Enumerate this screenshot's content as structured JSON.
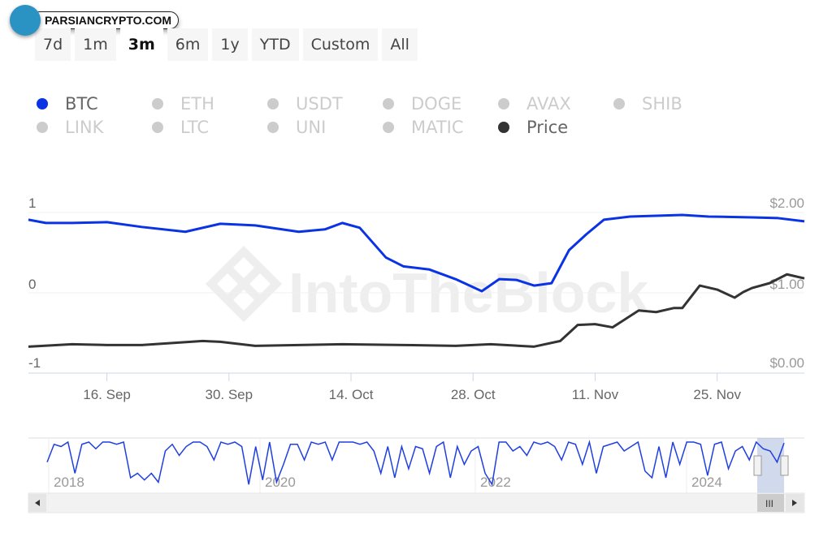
{
  "watermark_logo": "PARSIANCRYPTO.COM",
  "ranges": [
    {
      "label": "7d"
    },
    {
      "label": "1m"
    },
    {
      "label": "3m",
      "active": true
    },
    {
      "label": "6m"
    },
    {
      "label": "1y"
    },
    {
      "label": "YTD"
    },
    {
      "label": "Custom"
    },
    {
      "label": "All"
    }
  ],
  "legend": [
    {
      "label": "BTC",
      "color": "#0a33e6",
      "on": true
    },
    {
      "label": "ETH"
    },
    {
      "label": "USDT"
    },
    {
      "label": "DOGE"
    },
    {
      "label": "AVAX"
    },
    {
      "label": "SHIB"
    },
    {
      "label": "LINK"
    },
    {
      "label": "LTC"
    },
    {
      "label": "UNI"
    },
    {
      "label": "MATIC"
    },
    {
      "label": "Price",
      "color": "#333333",
      "on": true
    }
  ],
  "chart_data": {
    "type": "line",
    "watermark": "IntoTheBlock",
    "x_range": [
      "2024-09-07",
      "2024-12-05"
    ],
    "x_ticks": [
      {
        "date": "2024-09-16",
        "label": "16. Sep"
      },
      {
        "date": "2024-09-30",
        "label": "30. Sep"
      },
      {
        "date": "2024-10-14",
        "label": "14. Oct"
      },
      {
        "date": "2024-10-28",
        "label": "28. Oct"
      },
      {
        "date": "2024-11-11",
        "label": "11. Nov"
      },
      {
        "date": "2024-11-25",
        "label": "25. Nov"
      }
    ],
    "y_left": {
      "range": [
        -1,
        1
      ],
      "ticks": [
        "1",
        "0",
        "-1"
      ]
    },
    "y_right": {
      "range": [
        0,
        2
      ],
      "ticks": [
        "$2.00",
        "$1.00",
        "$0.00"
      ]
    },
    "grid": true,
    "series": [
      {
        "name": "BTC",
        "axis": "left",
        "color": "#0a33e6",
        "points": [
          [
            "2024-09-07",
            0.91
          ],
          [
            "2024-09-09",
            0.87
          ],
          [
            "2024-09-12",
            0.87
          ],
          [
            "2024-09-16",
            0.88
          ],
          [
            "2024-09-20",
            0.82
          ],
          [
            "2024-09-25",
            0.76
          ],
          [
            "2024-09-29",
            0.86
          ],
          [
            "2024-10-03",
            0.84
          ],
          [
            "2024-10-08",
            0.76
          ],
          [
            "2024-10-11",
            0.79
          ],
          [
            "2024-10-13",
            0.87
          ],
          [
            "2024-10-15",
            0.81
          ],
          [
            "2024-10-18",
            0.44
          ],
          [
            "2024-10-20",
            0.33
          ],
          [
            "2024-10-23",
            0.29
          ],
          [
            "2024-10-26",
            0.17
          ],
          [
            "2024-10-29",
            0.02
          ],
          [
            "2024-10-31",
            0.17
          ],
          [
            "2024-11-02",
            0.16
          ],
          [
            "2024-11-04",
            0.09
          ],
          [
            "2024-11-06",
            0.12
          ],
          [
            "2024-11-08",
            0.53
          ],
          [
            "2024-11-10",
            0.73
          ],
          [
            "2024-11-12",
            0.91
          ],
          [
            "2024-11-15",
            0.95
          ],
          [
            "2024-11-21",
            0.97
          ],
          [
            "2024-11-24",
            0.95
          ],
          [
            "2024-11-29",
            0.94
          ],
          [
            "2024-12-02",
            0.93
          ],
          [
            "2024-12-05",
            0.89
          ]
        ]
      },
      {
        "name": "Price",
        "axis": "right",
        "color": "#333333",
        "points": [
          [
            "2024-09-07",
            0.33
          ],
          [
            "2024-09-12",
            0.36
          ],
          [
            "2024-09-16",
            0.35
          ],
          [
            "2024-09-20",
            0.35
          ],
          [
            "2024-09-27",
            0.4
          ],
          [
            "2024-09-29",
            0.39
          ],
          [
            "2024-10-03",
            0.34
          ],
          [
            "2024-10-08",
            0.35
          ],
          [
            "2024-10-13",
            0.36
          ],
          [
            "2024-10-20",
            0.35
          ],
          [
            "2024-10-26",
            0.34
          ],
          [
            "2024-10-30",
            0.36
          ],
          [
            "2024-11-04",
            0.33
          ],
          [
            "2024-11-07",
            0.4
          ],
          [
            "2024-11-09",
            0.6
          ],
          [
            "2024-11-11",
            0.61
          ],
          [
            "2024-11-13",
            0.57
          ],
          [
            "2024-11-16",
            0.78
          ],
          [
            "2024-11-18",
            0.76
          ],
          [
            "2024-11-20",
            0.81
          ],
          [
            "2024-11-21",
            0.81
          ],
          [
            "2024-11-23",
            1.09
          ],
          [
            "2024-11-25",
            1.04
          ],
          [
            "2024-11-27",
            0.94
          ],
          [
            "2024-11-28",
            1.01
          ],
          [
            "2024-11-29",
            1.06
          ],
          [
            "2024-12-01",
            1.12
          ],
          [
            "2024-12-03",
            1.23
          ],
          [
            "2024-12-05",
            1.18
          ]
        ]
      }
    ],
    "navigator": {
      "year_labels": [
        "2018",
        "2020",
        "2022",
        "2024"
      ],
      "series": [
        0.55,
        0.95,
        0.9,
        1,
        0.3,
        0.95,
        1,
        0.85,
        1,
        1,
        0.95,
        1,
        0.2,
        0.3,
        0.15,
        0.3,
        0.1,
        0.8,
        0.95,
        0.7,
        0.9,
        1,
        1,
        0.9,
        0.6,
        1,
        0.95,
        1,
        0.9,
        0.05,
        0.9,
        0.15,
        1,
        0.1,
        0.5,
        0.95,
        0.95,
        0.6,
        1,
        0.95,
        1,
        0.6,
        1,
        1,
        1,
        0.95,
        1,
        0.8,
        0.3,
        0.9,
        0.2,
        0.9,
        0.4,
        0.9,
        0.85,
        0.3,
        0.9,
        1,
        0.2,
        0.9,
        0.5,
        0.8,
        0.9,
        0.3,
        0.05,
        1,
        1,
        0.8,
        0.9,
        0.7,
        1,
        0.95,
        1,
        0.9,
        0.6,
        1,
        0.95,
        0.5,
        1,
        0.3,
        0.9,
        0.95,
        1,
        0.8,
        0.9,
        1,
        0.35,
        0.2,
        0.9,
        0.2,
        1,
        0.5,
        1,
        1,
        0.95,
        0.25,
        0.95,
        1,
        0.4,
        0.8,
        0.9,
        0.6,
        1,
        0.85,
        0.8,
        0.55,
        0.98
      ]
    }
  }
}
